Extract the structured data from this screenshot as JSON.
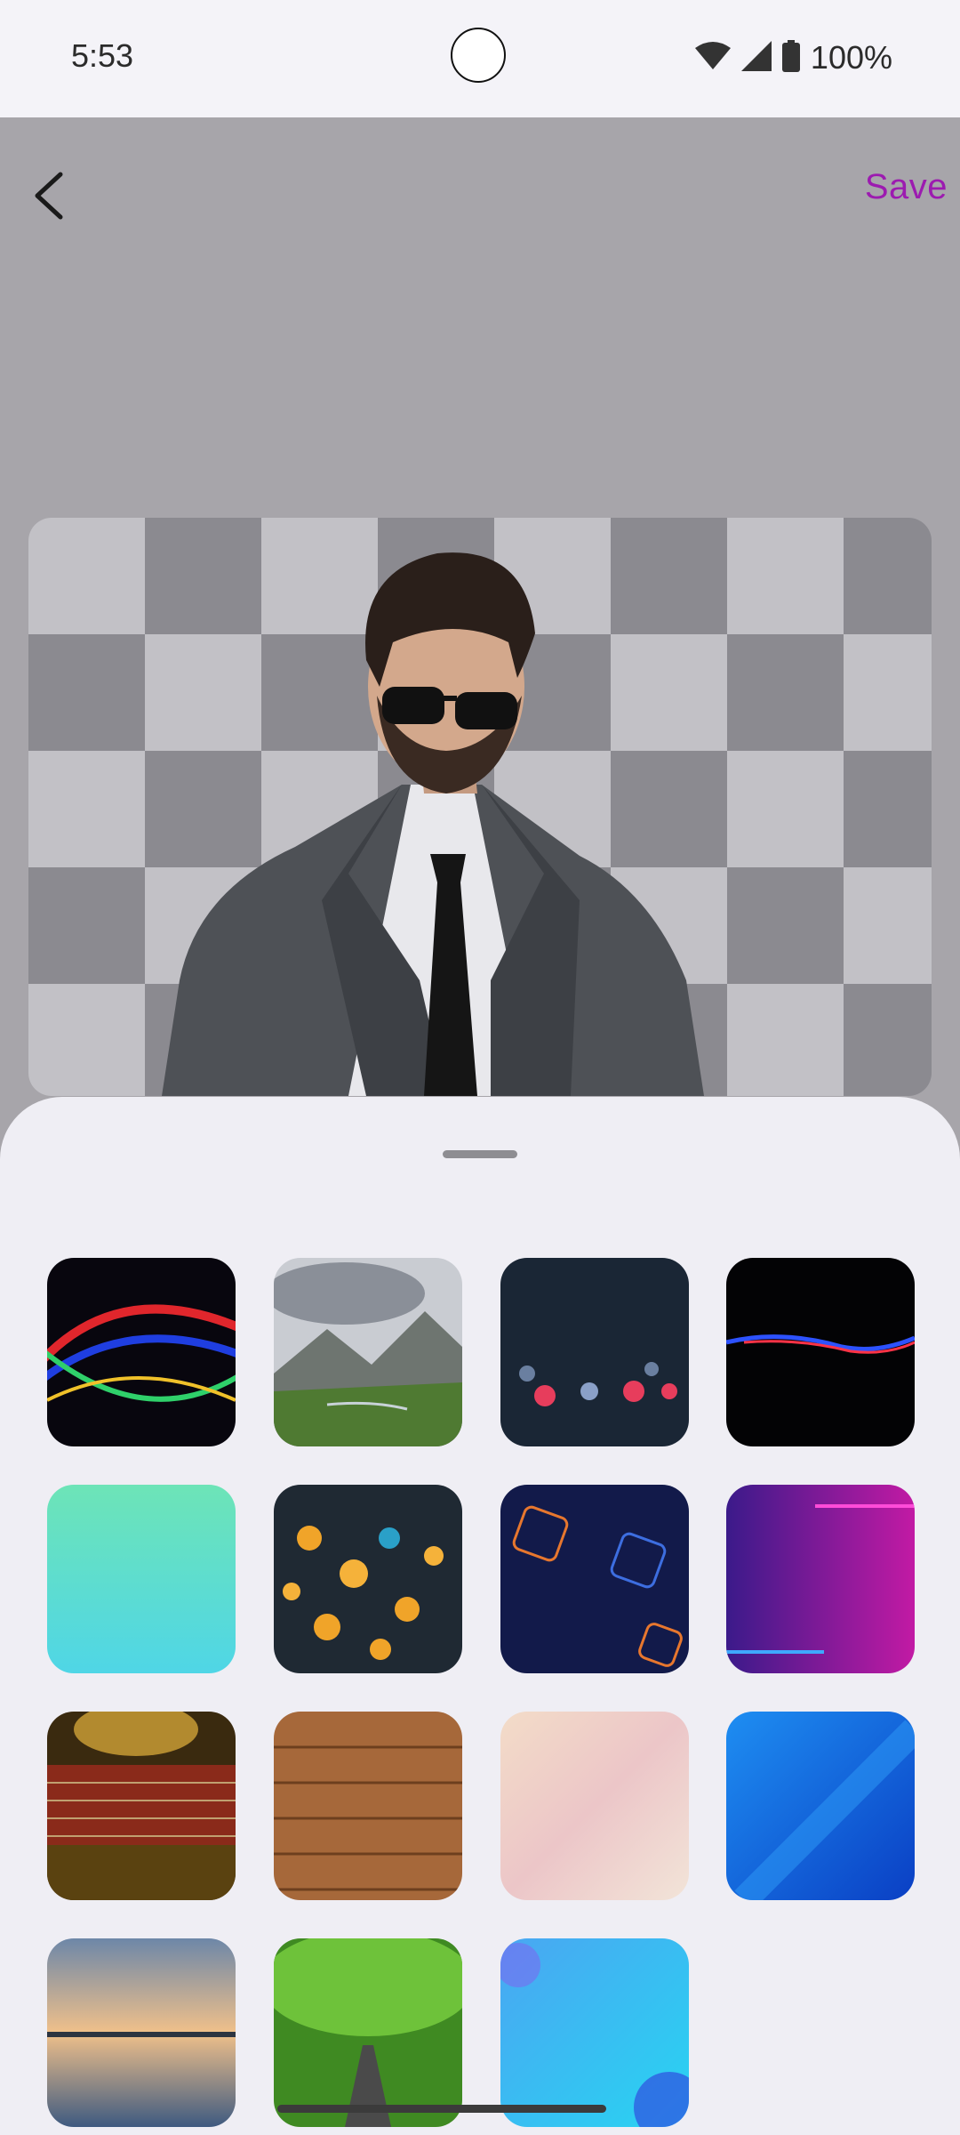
{
  "status_bar": {
    "time": "5:53",
    "battery": "100%",
    "icons": [
      "wifi-icon",
      "signal-icon",
      "battery-icon"
    ]
  },
  "toolbar": {
    "back_icon": "back-arrow-icon",
    "save_label": "Save",
    "save_color": "#9c1bb0"
  },
  "backgrounds": [
    {
      "name": "abstract-neon-waves"
    },
    {
      "name": "mountain-valley"
    },
    {
      "name": "city-bokeh-lights"
    },
    {
      "name": "neon-light-streak"
    },
    {
      "name": "aqua-clouds"
    },
    {
      "name": "golden-bokeh"
    },
    {
      "name": "blue-geometric-squares"
    },
    {
      "name": "purple-neon-brick-wall"
    },
    {
      "name": "red-brick-wall"
    },
    {
      "name": "wooden-planks"
    },
    {
      "name": "pastel-gradient"
    },
    {
      "name": "blue-abstract-gradient"
    },
    {
      "name": "sunset-lake"
    },
    {
      "name": "tree-lined-road"
    },
    {
      "name": "blue-bubbles-abstract"
    }
  ]
}
